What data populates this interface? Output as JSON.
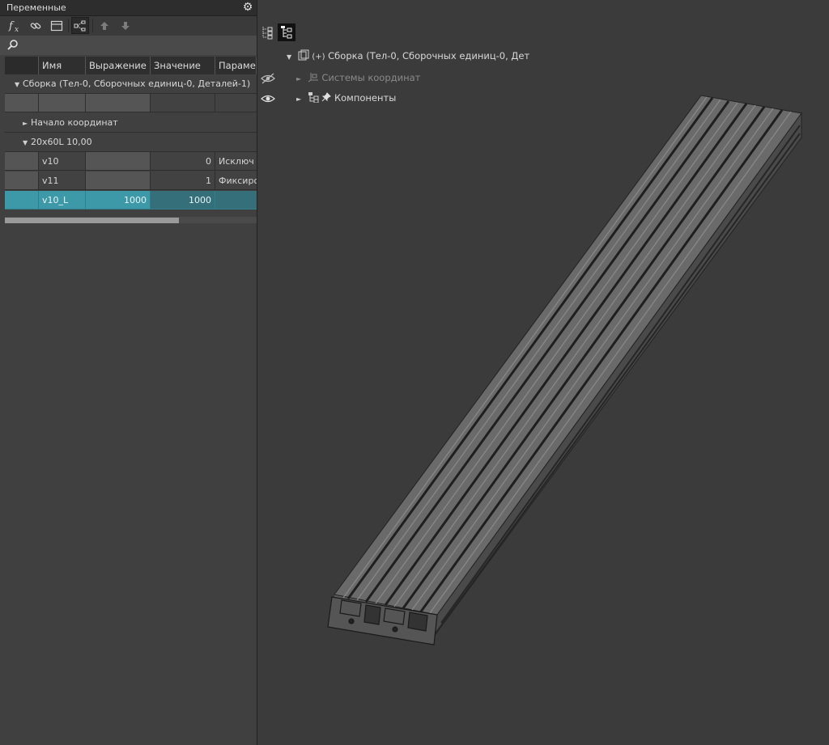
{
  "panel": {
    "title": "Переменные",
    "toolbar": {
      "icons": [
        "function-icon",
        "link-icon",
        "window-icon",
        "tree-view-icon",
        "arrow-up-icon",
        "arrow-down-icon"
      ],
      "function_glyph": "fx"
    },
    "search": {
      "placeholder": ""
    }
  },
  "table": {
    "columns": [
      "Имя",
      "Выражение",
      "Значение",
      "Парамет"
    ],
    "root_group": "Сборка (Тел-0, Сборочных единиц-0, Деталей-1)",
    "groups": [
      {
        "label": "Начало координат",
        "expanded": false
      },
      {
        "label": "20x60L 10,00",
        "expanded": true
      }
    ],
    "rows": [
      {
        "name": "v10",
        "expression": "",
        "value": "0",
        "param": "Исключ"
      },
      {
        "name": "v11",
        "expression": "",
        "value": "1",
        "param": "Фиксиро"
      },
      {
        "name": "v10_L",
        "expression": "1000",
        "value": "1000",
        "param": ""
      }
    ],
    "selected_row": 2,
    "hscroll_fraction": 0.69
  },
  "viewport": {
    "tree": {
      "root": "Сборка (Тел-0, Сборочных единиц-0, Дет",
      "children": [
        {
          "label": "Системы координат",
          "visible": false
        },
        {
          "label": "Компоненты",
          "visible": true
        }
      ]
    }
  },
  "colors": {
    "selection": "#3d99a8",
    "background": "#3b3b3b",
    "panel": "#404040"
  }
}
